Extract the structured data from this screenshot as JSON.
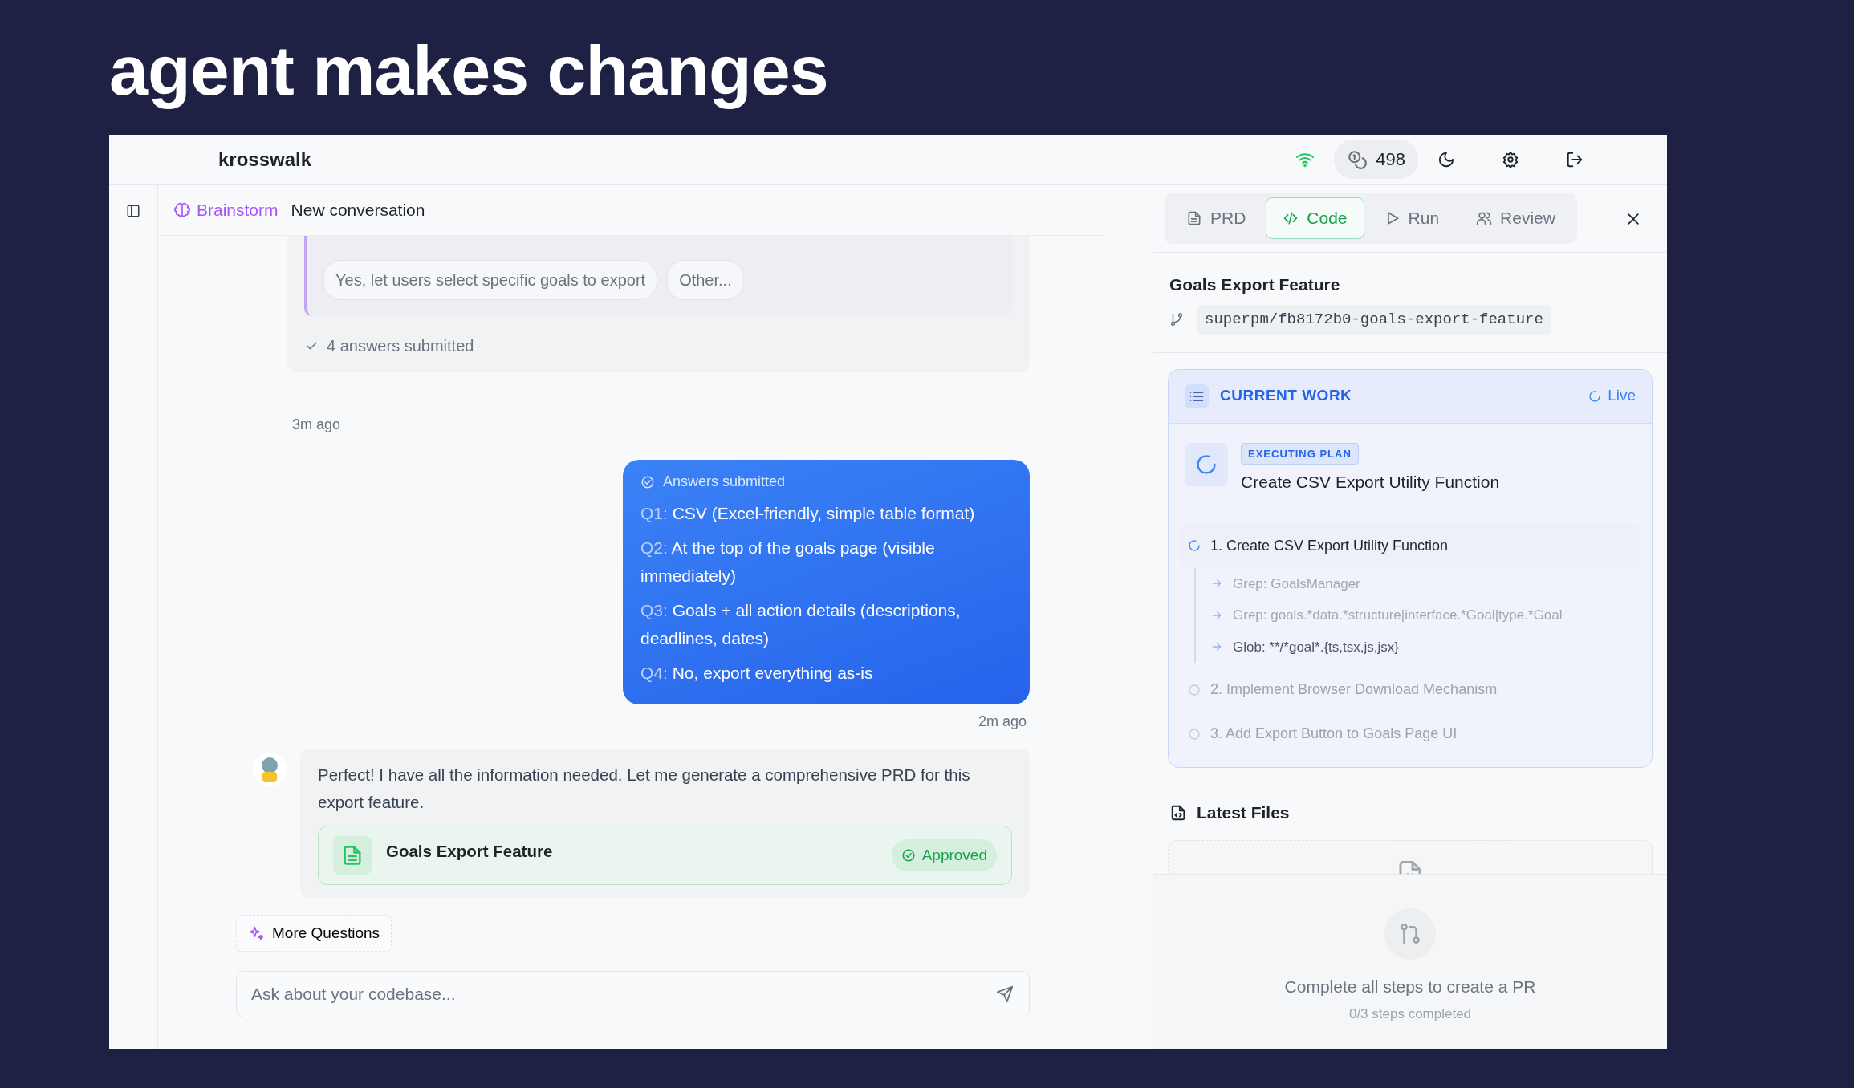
{
  "slide": {
    "title": "agent makes changes"
  },
  "app_header": {
    "brand": "krosswalk",
    "credits": "498"
  },
  "conversation_header": {
    "mode": "Brainstorm",
    "title": "New conversation"
  },
  "question_block": {
    "options": [
      {
        "label": "Yes, let users select specific goals to export"
      },
      {
        "label": "Other..."
      }
    ],
    "status": "4 answers submitted",
    "time": "3m ago"
  },
  "user_message": {
    "heading": "Answers submitted",
    "answers": [
      {
        "q": "Q1:",
        "text": "CSV (Excel-friendly, simple table format)"
      },
      {
        "q": "Q2:",
        "text": "At the top of the goals page (visible immediately)"
      },
      {
        "q": "Q3:",
        "text": "Goals + all action details (descriptions, deadlines, dates)"
      },
      {
        "q": "Q4:",
        "text": "No, export everything as-is"
      }
    ],
    "time": "2m ago"
  },
  "assistant_message": {
    "text": "Perfect! I have all the information needed. Let me generate a comprehensive PRD for this export feature.",
    "document": {
      "title": "Goals Export Feature",
      "status": "Approved"
    }
  },
  "more_questions": "More Questions",
  "composer": {
    "placeholder": "Ask about your codebase..."
  },
  "panel": {
    "tabs": [
      {
        "label": "PRD",
        "kind": "document",
        "selected": false
      },
      {
        "label": "Code",
        "kind": "code",
        "selected": true
      },
      {
        "label": "Run",
        "kind": "play",
        "selected": false
      },
      {
        "label": "Review",
        "kind": "people",
        "selected": false
      }
    ],
    "title": "Goals Export Feature",
    "branch": "superpm/fb8172b0-goals-export-feature",
    "current_work": {
      "heading": "CURRENT WORK",
      "live": "Live",
      "badge": "EXECUTING PLAN",
      "task": "Create CSV Export Utility Function",
      "steps": [
        {
          "label": "1. Create CSV Export Utility Function",
          "running": true,
          "children": [
            {
              "label": "Grep: GoalsManager",
              "current": false
            },
            {
              "label": "Grep: goals.*data.*structure|interface.*Goal|type.*Goal",
              "current": false
            },
            {
              "label": "Glob: **/*goal*.{ts,tsx,js,jsx}",
              "current": true
            }
          ]
        },
        {
          "label": "2. Implement Browser Download Mechanism",
          "running": false
        },
        {
          "label": "3. Add Export Button to Goals Page UI",
          "running": false
        }
      ]
    },
    "latest_files": {
      "heading": "Latest Files"
    },
    "pr": {
      "title": "Complete all steps to create a PR",
      "progress": "0/3 steps completed"
    }
  }
}
